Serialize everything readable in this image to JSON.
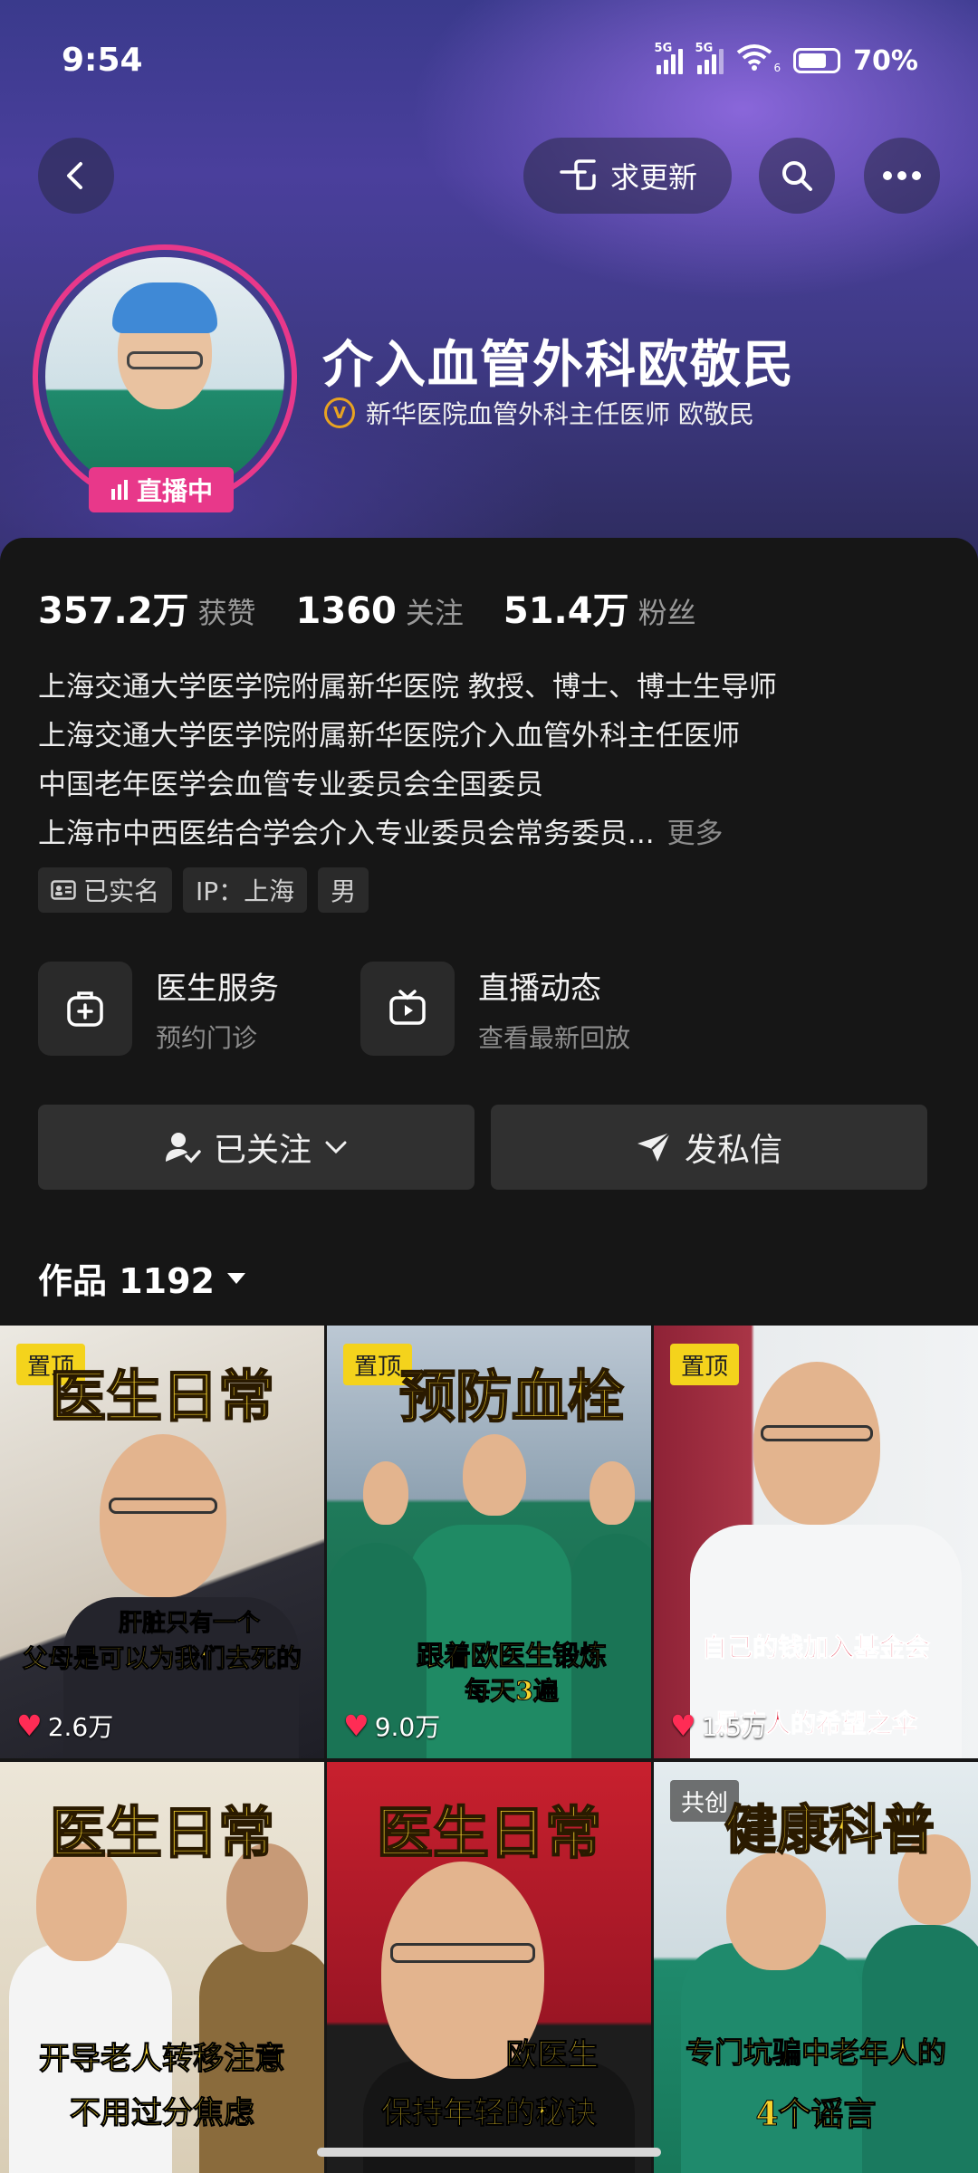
{
  "status_bar": {
    "time": "9:54",
    "signal1_tag": "5G",
    "signal2_tag": "5G",
    "wifi_tag": "6",
    "battery": "70%"
  },
  "nav": {
    "update_label": "求更新"
  },
  "profile": {
    "name": "介入血管外科欧敬民",
    "verify_text": "新华医院血管外科主任医师 欧敬民",
    "verify_badge": "V",
    "live_label": "直播中"
  },
  "stats": [
    {
      "num": "357.2万",
      "label": "获赞"
    },
    {
      "num": "1360",
      "label": "关注"
    },
    {
      "num": "51.4万",
      "label": "粉丝"
    }
  ],
  "bio": {
    "lines": [
      "上海交通大学医学院附属新华医院 教授、博士、博士生导师",
      "上海交通大学医学院附属新华医院介入血管外科主任医师",
      "中国老年医学会血管专业委员会全国委员",
      "上海市中西医结合学会介入专业委员会常务委员..."
    ],
    "more": "更多"
  },
  "tags": [
    "已实名",
    "IP：上海",
    "男"
  ],
  "services": [
    {
      "title": "医生服务",
      "sub": "预约门诊",
      "icon": "medical-kit-icon"
    },
    {
      "title": "直播动态",
      "sub": "查看最新回放",
      "icon": "tv-play-icon"
    }
  ],
  "actions": {
    "follow": "已关注",
    "message": "发私信"
  },
  "works": {
    "label": "作品 1192"
  },
  "videos": [
    {
      "badge": "置顶",
      "title": "医生日常",
      "caption1": "肝脏只有一个",
      "caption2": "父母是可以为我们去死的",
      "likes": "2.6万"
    },
    {
      "badge": "置顶",
      "title": "预防血栓",
      "caption1": "跟着欧医生锻炼",
      "caption2": "每天3遍",
      "likes": "9.0万"
    },
    {
      "badge": "置顶",
      "title": "",
      "caption1": "自己的钱加入基金会",
      "caption2": "是病人的希望之伞",
      "likes": "1.5万"
    },
    {
      "badge": "",
      "title": "医生日常",
      "caption1": "开导老人转移注意",
      "caption2": "不用过分焦虑",
      "likes": ""
    },
    {
      "badge": "",
      "title": "医生日常",
      "caption1": "欧医生",
      "caption2": "保持年轻的秘诀",
      "likes": ""
    },
    {
      "badge": "共创",
      "title": "健康科普",
      "caption1": "专门坑骗中老年人的",
      "caption2": "4个谣言",
      "likes": ""
    }
  ]
}
